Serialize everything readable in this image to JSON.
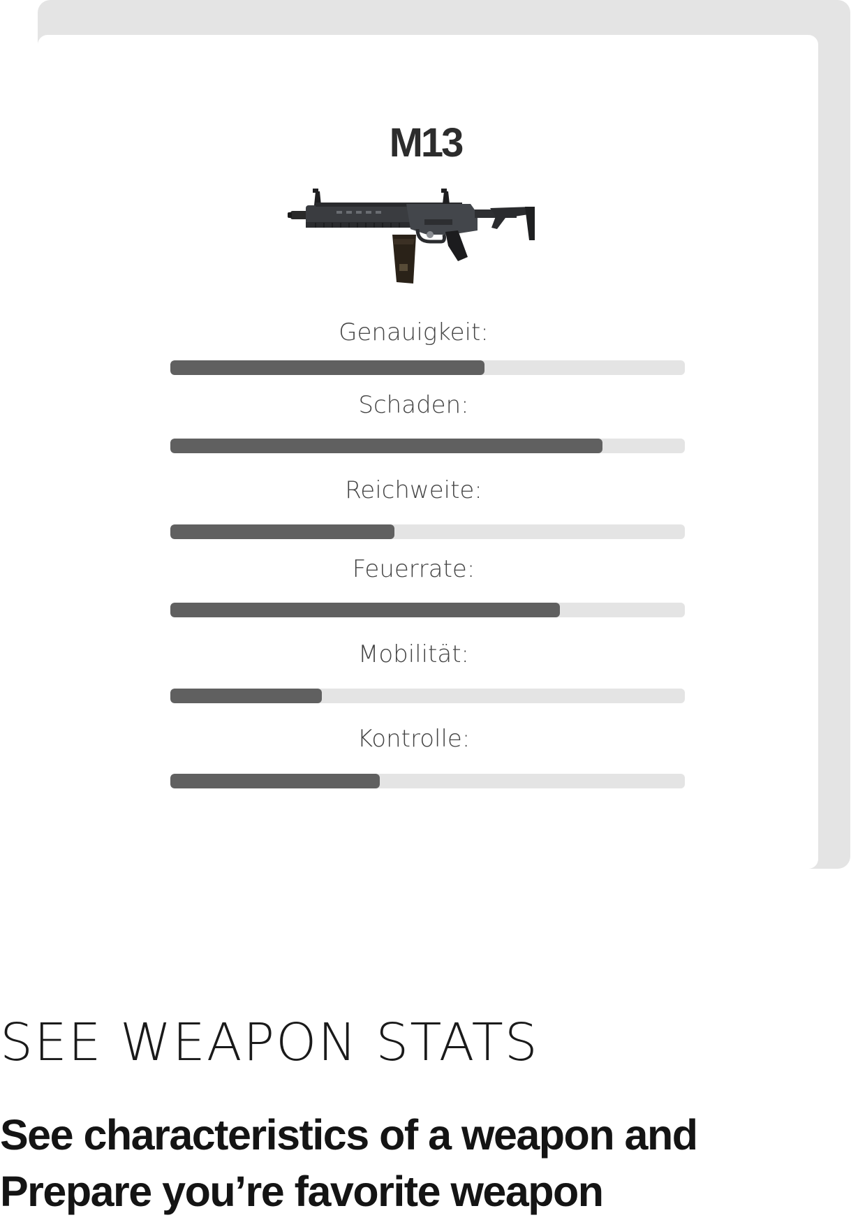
{
  "weapon": {
    "name": "M13",
    "image_icon": "assault-rifle-icon"
  },
  "stats": [
    {
      "label": "Genauigkeit:",
      "value": 0.61
    },
    {
      "label": "Schaden:",
      "value": 0.84
    },
    {
      "label": "Reichweite:",
      "value": 0.435
    },
    {
      "label": "Feuerrate:",
      "value": 0.757
    },
    {
      "label": "Mobilität:",
      "value": 0.295
    },
    {
      "label": "Kontrolle:",
      "value": 0.407
    }
  ],
  "section": {
    "heading": "SEE WEAPON STATS",
    "description_line1": "See characteristics of a weapon and",
    "description_line2": "Prepare you’re favorite weapon"
  },
  "colors": {
    "card_shadow": "#e4e4e4",
    "bar_track": "#e4e4e4",
    "bar_fill": "#606060",
    "text_dark": "#2c2c2c"
  }
}
